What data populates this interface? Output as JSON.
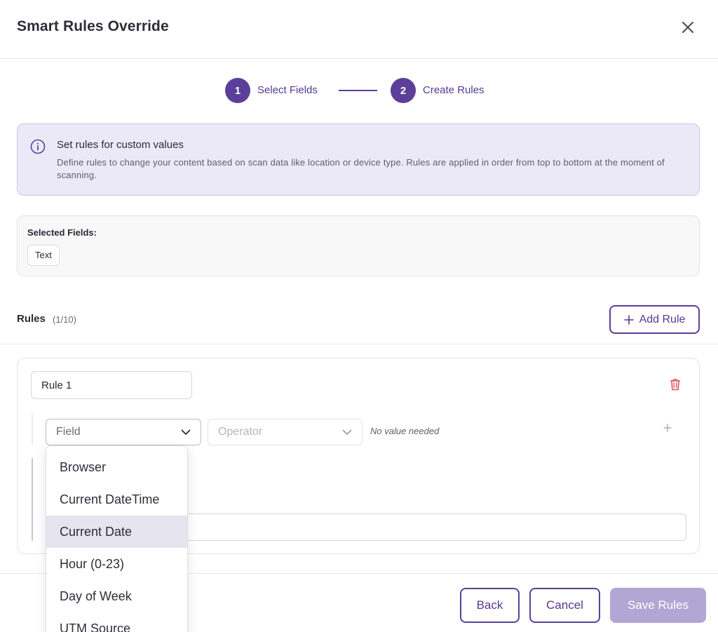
{
  "header": {
    "title": "Smart Rules Override"
  },
  "stepper": {
    "steps": [
      {
        "number": "1",
        "label": "Select Fields"
      },
      {
        "number": "2",
        "label": "Create Rules"
      }
    ]
  },
  "info": {
    "title": "Set rules for custom values",
    "description": "Define rules to change your content based on scan data like location or device type. Rules are applied in order from top to bottom at the moment of scanning."
  },
  "selected_fields": {
    "label": "Selected Fields:",
    "chips": [
      "Text"
    ]
  },
  "rules": {
    "heading": "Rules",
    "count": "(1/10)",
    "add_label": "Add Rule"
  },
  "rule": {
    "name_value": "Rule 1",
    "field_placeholder": "Field",
    "operator_placeholder": "Operator",
    "no_value_text": "No value needed"
  },
  "field_dropdown": {
    "options": [
      "Browser",
      "Current DateTime",
      "Current Date",
      "Hour (0-23)",
      "Day of Week",
      "UTM Source"
    ],
    "highlighted": "Current Date"
  },
  "footer": {
    "back_label": "Back",
    "cancel_label": "Cancel",
    "save_label": "Save Rules"
  },
  "colors": {
    "accent": "#5b3f99",
    "info_bg": "#ebe9f7",
    "save_disabled": "#b2a6d4",
    "danger": "#d9534f"
  }
}
